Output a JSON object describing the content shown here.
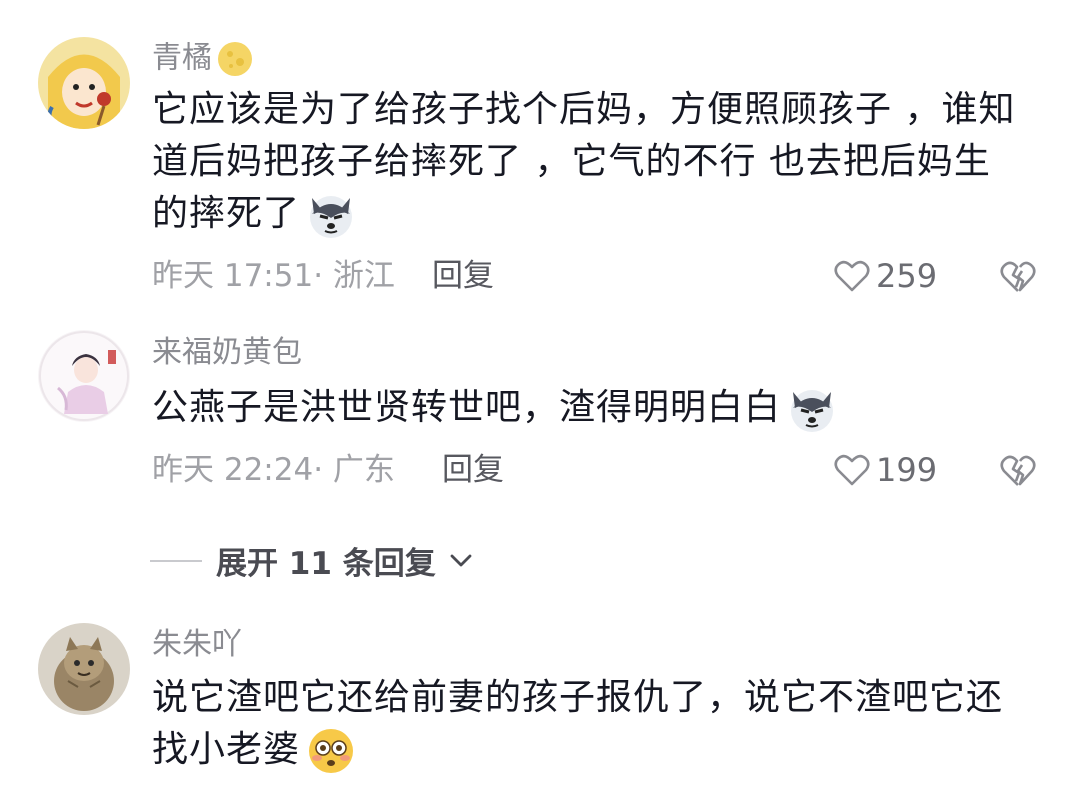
{
  "comments": [
    {
      "username": "青橘",
      "text": "它应该是为了给孩子找个后妈，方便照顾孩子 ，谁知\n道后妈把孩子给摔死了 ，它气的不行 也去把后妈生\n的摔死了",
      "emoji": "dog-smirk-emoji",
      "meta": "昨天 17:51· 浙江",
      "reply_label": "回复",
      "likes": "259"
    },
    {
      "username": "来福奶黄包",
      "text": "公燕子是洪世贤转世吧，渣得明明白白",
      "emoji": "dog-smirk-emoji",
      "meta": "昨天 22:24· 广东",
      "reply_label": "回复",
      "likes": "199"
    },
    {
      "username": "朱朱吖",
      "text": "说它渣吧它还给前妻的孩子报仇了，说它不渣吧它还\n找小老婆",
      "emoji": "flushed-face-emoji"
    }
  ],
  "expand_replies": {
    "label": "展开 11 条回复"
  }
}
